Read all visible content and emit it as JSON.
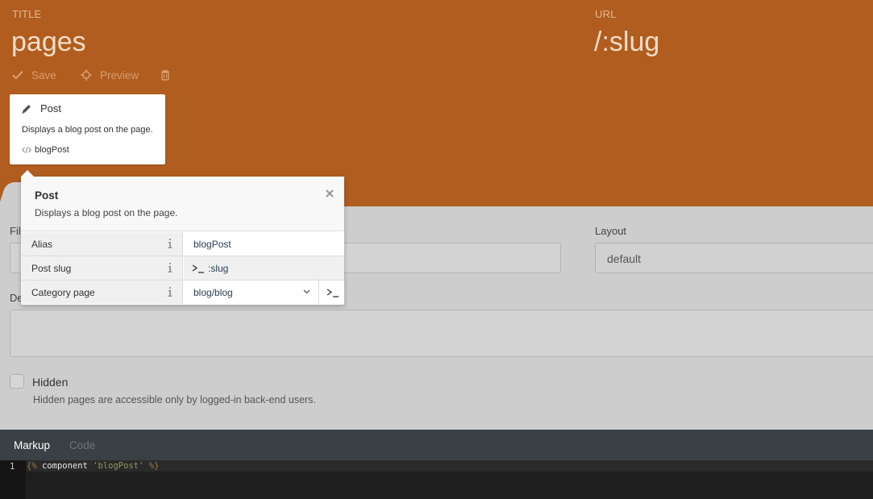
{
  "header": {
    "title_label": "TITLE",
    "title_value": "pages",
    "url_label": "URL",
    "url_value": "/:slug",
    "toolbar": {
      "save_label": "Save",
      "preview_label": "Preview"
    }
  },
  "component_card": {
    "title": "Post",
    "description": "Displays a blog post on the page.",
    "alias": "blogPost"
  },
  "form": {
    "file_label": "Fil",
    "layout_label": "Layout",
    "layout_value": "default",
    "description_label": "De",
    "hidden_label": "Hidden",
    "hidden_help": "Hidden pages are accessible only by logged-in back-end users."
  },
  "popup": {
    "title": "Post",
    "description": "Displays a blog post on the page.",
    "properties": [
      {
        "key": "Alias",
        "value": "blogPost"
      },
      {
        "key": "Post slug",
        "value": ":slug"
      },
      {
        "key": "Category page",
        "value": "blog/blog"
      }
    ]
  },
  "editor": {
    "tabs": [
      "Markup",
      "Code"
    ],
    "line_number": "1",
    "code": {
      "open": "{%",
      "keyword": " component ",
      "string": "'blogPost'",
      "close": " %}"
    }
  },
  "colors": {
    "header_bg": "#b05d1f",
    "form_bg": "#cdcdcd",
    "editor_bg": "#1e1e1e"
  }
}
